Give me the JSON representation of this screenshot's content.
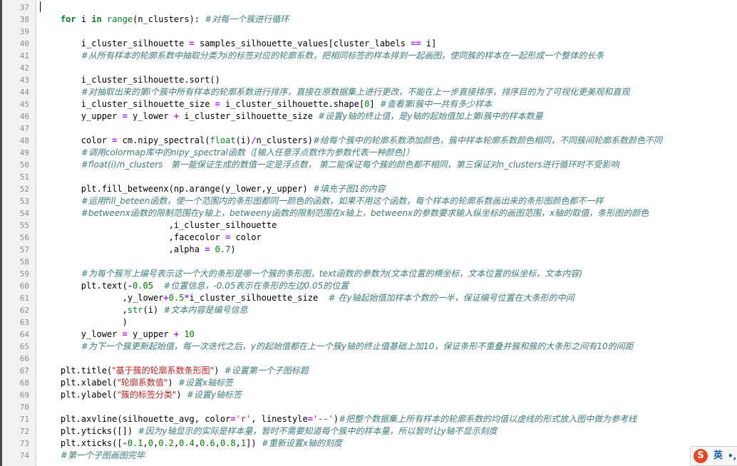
{
  "editor": {
    "lines": [
      {
        "n": "37",
        "t": []
      },
      {
        "n": "38",
        "t": [
          [
            "    ",
            ""
          ],
          [
            "for",
            "kw"
          ],
          [
            " i ",
            ""
          ],
          [
            "in",
            "kw"
          ],
          [
            " ",
            ""
          ],
          [
            "range",
            "bi"
          ],
          [
            "(n_clusters): ",
            ""
          ],
          [
            "#对每一个簇进行循环",
            "cm cjk"
          ]
        ]
      },
      {
        "n": "39",
        "t": []
      },
      {
        "n": "40",
        "t": [
          [
            "        i_cluster_silhouette ",
            ""
          ],
          [
            "=",
            "op"
          ],
          [
            " samples_silhouette_values[cluster_labels ",
            ""
          ],
          [
            "==",
            "op"
          ],
          [
            " i]",
            ""
          ]
        ]
      },
      {
        "n": "41",
        "t": [
          [
            "        ",
            ""
          ],
          [
            "#从所有样本的轮廓系数中抽取分类为i的标签对应的轮廓系数，把相同标签的样本排到一起画图，使同簇的样本在一起形成一个整体的长条",
            "cm cjk"
          ]
        ]
      },
      {
        "n": "42",
        "t": []
      },
      {
        "n": "43",
        "t": [
          [
            "        i_cluster_silhouette.sort()",
            ""
          ]
        ]
      },
      {
        "n": "44",
        "t": [
          [
            "        ",
            ""
          ],
          [
            "#对抽取出来的第i个簇中所有样本的轮廓系数进行排序，直接在原数据集上进行更改，不能在上一步直接排序，排序目的为了可视化更美观和直观",
            "cm cjk"
          ]
        ]
      },
      {
        "n": "45",
        "t": [
          [
            "        i_cluster_silhouette_size ",
            ""
          ],
          [
            "=",
            "op"
          ],
          [
            " i_cluster_silhouette.shape[",
            ""
          ],
          [
            "0",
            "num"
          ],
          [
            "] ",
            ""
          ],
          [
            "#查看第i簇中一共有多少样本",
            "cm cjk"
          ]
        ]
      },
      {
        "n": "46",
        "t": [
          [
            "        y_upper ",
            ""
          ],
          [
            "=",
            "op"
          ],
          [
            " y_lower ",
            ""
          ],
          [
            "+",
            "op"
          ],
          [
            " i_cluster_silhouette_size ",
            ""
          ],
          [
            "#设置y轴的终止值，是y轴的起始值加上第i簇中的样本数量",
            "cm cjk"
          ]
        ]
      },
      {
        "n": "47",
        "t": []
      },
      {
        "n": "48",
        "t": [
          [
            "        color ",
            ""
          ],
          [
            "=",
            "op"
          ],
          [
            " cm.nipy_spectral(",
            ""
          ],
          [
            "float",
            "bi"
          ],
          [
            "(i)",
            ""
          ],
          [
            "/",
            "op"
          ],
          [
            "n_clusters)",
            ""
          ],
          [
            "#给每个簇中的轮廓系数添加颜色，簇中样本轮廓系数颜色相同，不同簇间轮廓系数颜色不同",
            "cm cjk"
          ]
        ]
      },
      {
        "n": "49",
        "t": [
          [
            "        ",
            ""
          ],
          [
            "#调用colormap库中的nipy_spectral函数（[输入任意浮点数作为参数代表一种颜色]）",
            "cm cjk"
          ]
        ]
      },
      {
        "n": "50",
        "t": [
          [
            "        ",
            ""
          ],
          [
            "#float(i)/n_clusters   第一能保证生成的数值一定是浮点数， 第二能保证每个簇的颜色都不相同，第三保证对n_clusters进行循环时不受影响",
            "cm cjk"
          ]
        ]
      },
      {
        "n": "51",
        "t": []
      },
      {
        "n": "52",
        "t": [
          [
            "        plt.fill_betweenx(np.arange(y_lower,y_upper) ",
            ""
          ],
          [
            "#填充子图1的内容",
            "cm cjk"
          ]
        ]
      },
      {
        "n": "53",
        "t": [
          [
            "        ",
            ""
          ],
          [
            "#运用fill_beteen函数，使一个范围内的条形图都同一颜色的函数，如果不用这个函数，每个样本的轮廓系数画出来的条形图颜色都不一样",
            "cm cjk"
          ]
        ]
      },
      {
        "n": "54",
        "t": [
          [
            "        ",
            ""
          ],
          [
            "#betweenx函数的限制范围在y轴上，betweeny函数的限制范围在x轴上，betweenx的参数要求输入纵坐标的画图范围，x轴的取值，条形图的颜色",
            "cm cjk"
          ]
        ]
      },
      {
        "n": "55",
        "t": [
          [
            "                         ,i_cluster_silhouette",
            ""
          ]
        ]
      },
      {
        "n": "56",
        "t": [
          [
            "                         ,facecolor ",
            ""
          ],
          [
            "=",
            "op"
          ],
          [
            " color",
            ""
          ]
        ]
      },
      {
        "n": "57",
        "t": [
          [
            "                         ,alpha ",
            ""
          ],
          [
            "=",
            "op"
          ],
          [
            " ",
            ""
          ],
          [
            "0.7",
            "num"
          ],
          [
            ")",
            ""
          ]
        ]
      },
      {
        "n": "58",
        "t": []
      },
      {
        "n": "59",
        "t": [
          [
            "        ",
            ""
          ],
          [
            "#为每个簇写上编号表示这一个大的条形是哪一个簇的条形图，text函数的参数为(文本位置的横坐标，文本位置的纵坐标，文本内容)",
            "cm cjk"
          ]
        ]
      },
      {
        "n": "60",
        "t": [
          [
            "        plt.text(",
            ""
          ],
          [
            "-",
            "op"
          ],
          [
            "0.05",
            "num"
          ],
          [
            "  ",
            ""
          ],
          [
            "#位置信息，-0.05表示在条形的左边0.05的位置",
            "cm cjk"
          ]
        ]
      },
      {
        "n": "61",
        "t": [
          [
            "                ,y_lower",
            ""
          ],
          [
            "+",
            "op"
          ],
          [
            "0.5",
            "num"
          ],
          [
            "*",
            "op"
          ],
          [
            "i_cluster_silhouette_size  ",
            ""
          ],
          [
            "# 在y轴起始值加样本个数的一半，保证编号位置在大条形的中间",
            "cm cjk"
          ]
        ]
      },
      {
        "n": "62",
        "t": [
          [
            "                ,",
            ""
          ],
          [
            "str",
            "bi"
          ],
          [
            "(i) ",
            ""
          ],
          [
            "#文本内容是编号信息",
            "cm cjk"
          ]
        ]
      },
      {
        "n": "63",
        "t": [
          [
            "                )",
            ""
          ]
        ]
      },
      {
        "n": "64",
        "t": [
          [
            "        y_lower ",
            ""
          ],
          [
            "=",
            "op"
          ],
          [
            " y_upper ",
            ""
          ],
          [
            "+",
            "op"
          ],
          [
            " ",
            ""
          ],
          [
            "10",
            "num"
          ]
        ]
      },
      {
        "n": "65",
        "t": [
          [
            "        ",
            ""
          ],
          [
            "#为下一个簇更新起始值，每一次迭代之后，y的起始值都在上一个簇y轴的终止值基础上加10，保证条形不重叠并簇和簇的大条形之间有10的间距",
            "cm cjk"
          ]
        ]
      },
      {
        "n": "66",
        "t": []
      },
      {
        "n": "67",
        "t": [
          [
            "    plt.title(",
            ""
          ],
          [
            "\"基于簇的轮廓系数条形图\"",
            "str cjk"
          ],
          [
            ") ",
            ""
          ],
          [
            "#设置第一个子图标题",
            "cm cjk"
          ]
        ]
      },
      {
        "n": "68",
        "t": [
          [
            "    plt.xlabel(",
            ""
          ],
          [
            "\"轮廓系数值\"",
            "str cjk"
          ],
          [
            ") ",
            ""
          ],
          [
            "#设置x轴标签",
            "cm cjk"
          ]
        ]
      },
      {
        "n": "69",
        "t": [
          [
            "    plt.ylabel(",
            ""
          ],
          [
            "\"簇的标签分类\"",
            "str cjk"
          ],
          [
            ") ",
            ""
          ],
          [
            "#设置y轴标签",
            "cm cjk"
          ]
        ]
      },
      {
        "n": "70",
        "t": []
      },
      {
        "n": "71",
        "t": [
          [
            "    plt.axvline(silhouette_avg, color",
            ""
          ],
          [
            "=",
            "op"
          ],
          [
            "'r'",
            "str"
          ],
          [
            ", linestyle",
            ""
          ],
          [
            "=",
            "op"
          ],
          [
            "'--'",
            "str"
          ],
          [
            ")",
            ""
          ],
          [
            "#把整个数据集上所有样本的轮廓系数的均值以虚线的形式放入图中做为参考线",
            "cm cjk"
          ]
        ]
      },
      {
        "n": "72",
        "t": [
          [
            "    plt.yticks([]) ",
            ""
          ],
          [
            "#因为y轴显示的实际是样本量，暂时不需要知道每个簇中的样本量，所以暂时让y轴不显示刻度",
            "cm cjk"
          ]
        ]
      },
      {
        "n": "73",
        "t": [
          [
            "    plt.xticks([",
            ""
          ],
          [
            "-",
            "op"
          ],
          [
            "0.1",
            "num"
          ],
          [
            ",",
            ""
          ],
          [
            "0",
            "num"
          ],
          [
            ",",
            ""
          ],
          [
            "0.2",
            "num"
          ],
          [
            ",",
            ""
          ],
          [
            "0.4",
            "num"
          ],
          [
            ",",
            ""
          ],
          [
            "0.6",
            "num"
          ],
          [
            ",",
            ""
          ],
          [
            "0.8",
            "num"
          ],
          [
            ",",
            ""
          ],
          [
            "1",
            "num"
          ],
          [
            "]) ",
            ""
          ],
          [
            "#重新设置x轴的刻度",
            "cm cjk"
          ]
        ]
      },
      {
        "n": "74",
        "t": [
          [
            "    ",
            ""
          ],
          [
            "#第一个子图画图完毕",
            "cm cjk"
          ]
        ]
      }
    ]
  },
  "ime": {
    "logo": "S",
    "lang": "英",
    "dots": "•,"
  }
}
